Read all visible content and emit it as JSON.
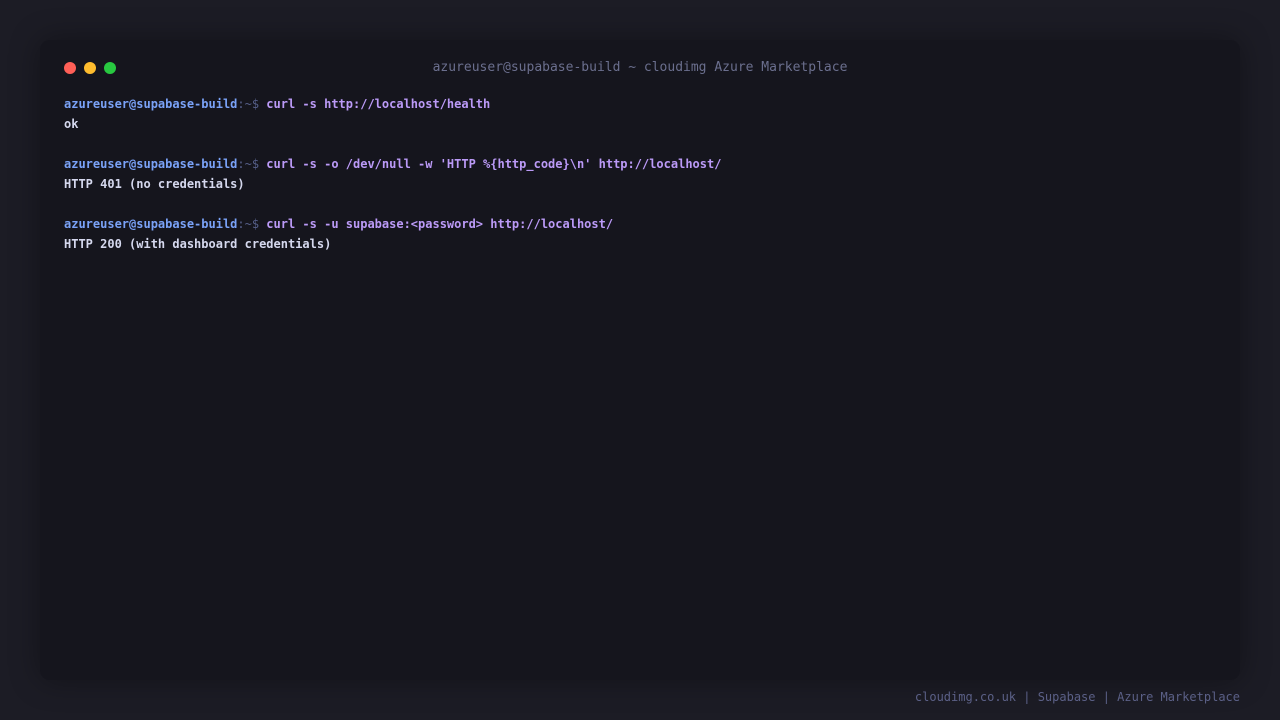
{
  "window": {
    "title": "azureuser@supabase-build ~ cloudimg Azure Marketplace",
    "controls": [
      {
        "name": "close",
        "color": "#ff5f57"
      },
      {
        "name": "minimize",
        "color": "#febc2e"
      },
      {
        "name": "maximize",
        "color": "#28c840"
      }
    ]
  },
  "terminal": {
    "entries": [
      {
        "prompt_user": "azureuser@supabase-build",
        "prompt_path": ":~$ ",
        "command": "curl -s http://localhost/health",
        "output": "ok"
      },
      {
        "prompt_user": "azureuser@supabase-build",
        "prompt_path": ":~$ ",
        "command": "curl -s -o /dev/null -w 'HTTP %{http_code}\\n' http://localhost/",
        "output": "HTTP 401 (no credentials)"
      },
      {
        "prompt_user": "azureuser@supabase-build",
        "prompt_path": ":~$ ",
        "command": "curl -s -u supabase:<password> http://localhost/",
        "output": "HTTP 200 (with dashboard credentials)"
      }
    ]
  },
  "footer": {
    "text": "cloudimg.co.uk | Supabase | Azure Marketplace"
  },
  "colors": {
    "background": "#1c1c25",
    "window": "#15151d",
    "prompt_user": "#7aa2f7",
    "prompt_path": "#565f89",
    "command": "#bb9af7",
    "output": "#d5d8ee"
  }
}
